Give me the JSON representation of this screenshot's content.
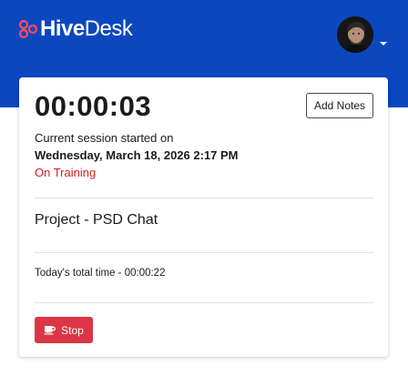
{
  "brand": {
    "hive": "Hive",
    "desk": "Desk",
    "logo_icon": "hivedesk-logo-icon",
    "colors": {
      "header_bg": "#0b47bf",
      "logo_accent": "#ff4b5c",
      "stop_button": "#dc3545",
      "status_text": "#d31f1f"
    }
  },
  "user_menu": {
    "avatar_icon": "user-avatar",
    "dropdown_icon": "caret-down-icon"
  },
  "timer": {
    "elapsed": "00:00:03",
    "add_notes_label": "Add Notes"
  },
  "session": {
    "label": "Current session started on",
    "started_at": "Wednesday, March 18, 2026 2:17 PM",
    "status": "On Training"
  },
  "project": {
    "label": "Project - PSD Chat"
  },
  "totals": {
    "today": "Today's total time - 00:00:22"
  },
  "actions": {
    "stop_label": "Stop",
    "stop_icon": "coffee-cup-icon"
  }
}
